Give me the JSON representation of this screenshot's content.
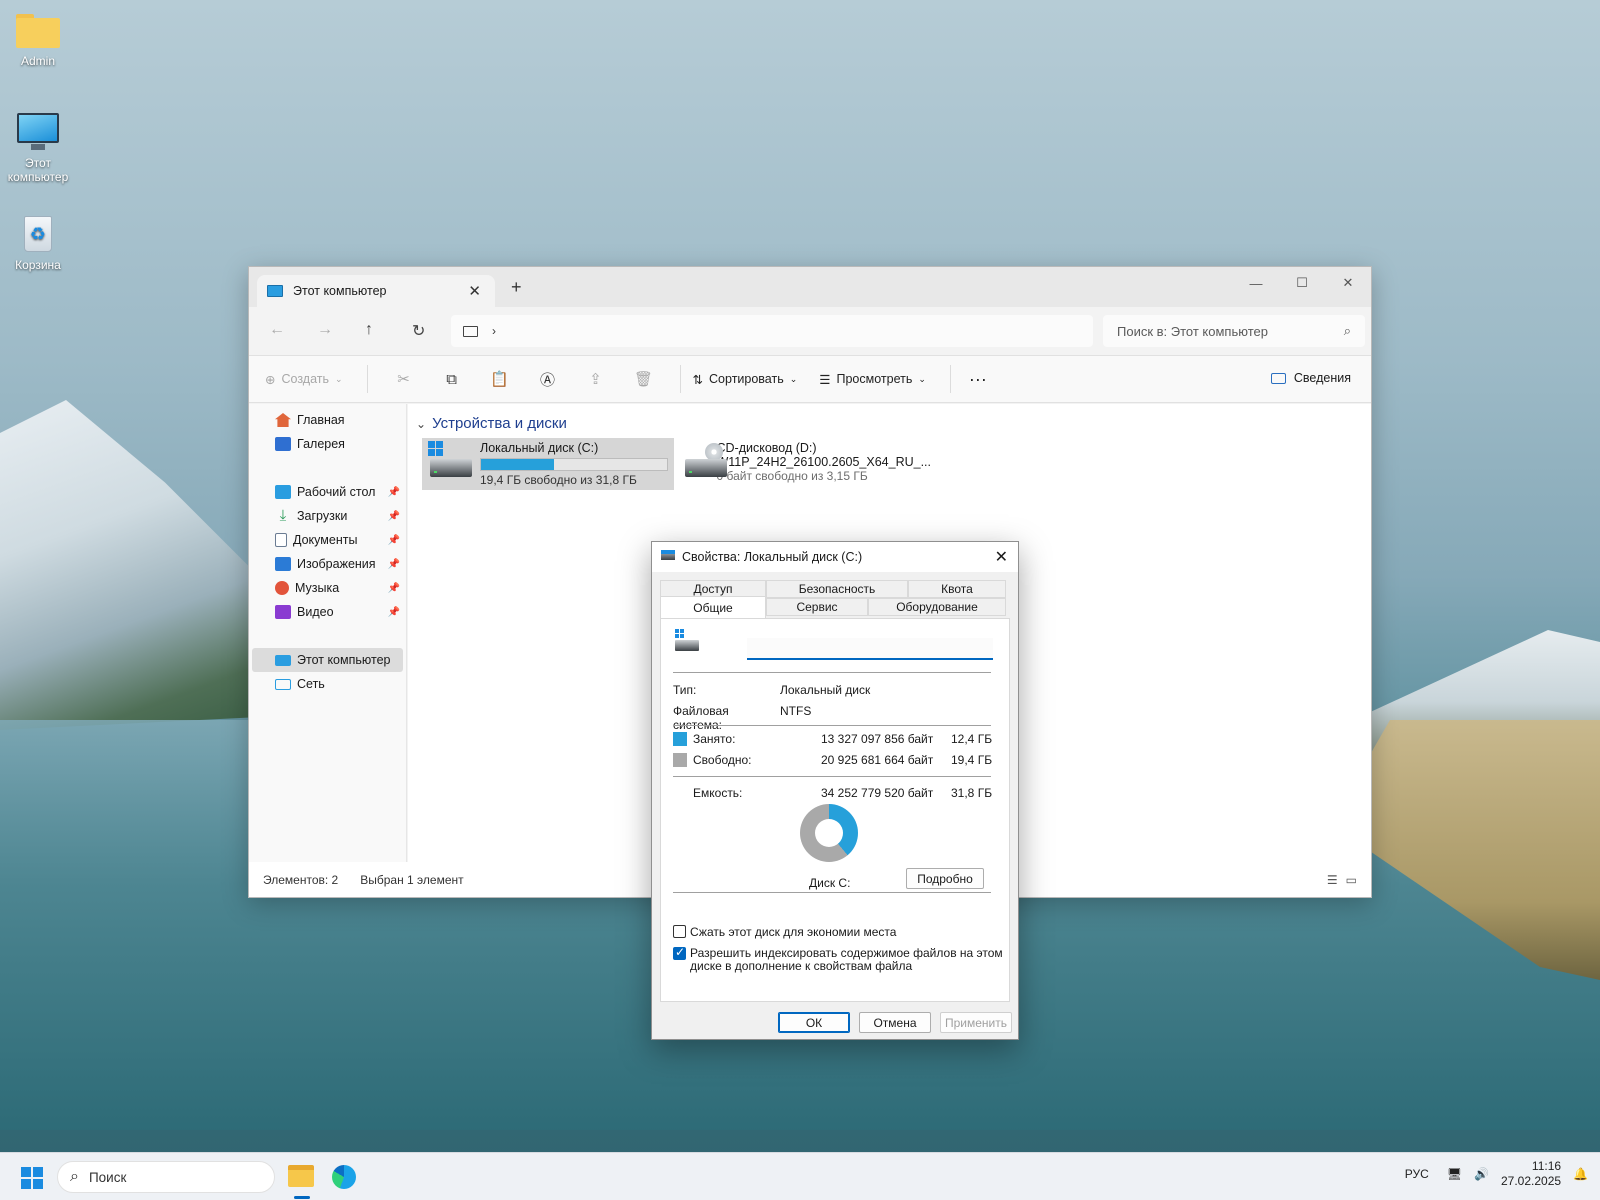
{
  "desktop": {
    "icons": [
      {
        "label": "Admin",
        "icon": "folder-icon"
      },
      {
        "label": "Этот компьютер",
        "icon": "monitor-icon"
      },
      {
        "label": "Корзина",
        "icon": "recycle-bin-icon"
      }
    ]
  },
  "explorer": {
    "tab_title": "Этот компьютер",
    "search_placeholder": "Поиск в: Этот компьютер",
    "toolbar": {
      "create": "Создать",
      "sort": "Сортировать",
      "view": "Просмотреть",
      "details": "Сведения"
    },
    "sidebar": {
      "items": [
        {
          "label": "Главная",
          "icon": "home-icon",
          "color": "#e0663b"
        },
        {
          "label": "Галерея",
          "icon": "gallery-icon",
          "color": "#2f6fd1"
        },
        {
          "label": "Рабочий стол",
          "icon": "desktop-icon",
          "color": "#2a9de0",
          "pinned": true
        },
        {
          "label": "Загрузки",
          "icon": "download-icon",
          "color": "#2c9b5a",
          "pinned": true
        },
        {
          "label": "Документы",
          "icon": "document-icon",
          "color": "#6b7c93",
          "pinned": true
        },
        {
          "label": "Изображения",
          "icon": "images-icon",
          "color": "#2b7bd6",
          "pinned": true
        },
        {
          "label": "Музыка",
          "icon": "music-icon",
          "color": "#e2543b",
          "pinned": true
        },
        {
          "label": "Видео",
          "icon": "video-icon",
          "color": "#8a3bd1",
          "pinned": true
        },
        {
          "label": "Этот компьютер",
          "icon": "pc-icon",
          "color": "#2a9de0",
          "selected": true
        },
        {
          "label": "Сеть",
          "icon": "network-icon",
          "color": "#2a9de0"
        }
      ]
    },
    "section_title": "Устройства и диски",
    "drives": [
      {
        "name": "Локальный диск (C:)",
        "free_text": "19,4 ГБ свободно из 31,8 ГБ",
        "used_fraction": 0.39,
        "selected": true
      },
      {
        "name": "CD-дисковод (D:)",
        "volume": "W11P_24H2_26100.2605_X64_RU_...",
        "free_text": "0 байт свободно из 3,15 ГБ"
      }
    ],
    "status": {
      "count": "Элементов: 2",
      "selected": "Выбран 1 элемент"
    }
  },
  "dialog": {
    "title": "Свойства: Локальный диск (C:)",
    "tabs_top": [
      "Доступ",
      "Безопасность",
      "Квота"
    ],
    "tabs_bottom": [
      "Общие",
      "Сервис",
      "Оборудование"
    ],
    "active_tab": "Общие",
    "name_value": "",
    "type_label": "Тип:",
    "type_value": "Локальный диск",
    "fs_label": "Файловая система:",
    "fs_value": "NTFS",
    "used_label": "Занято:",
    "used_bytes": "13 327 097 856 байт",
    "used_size": "12,4 ГБ",
    "free_label": "Свободно:",
    "free_bytes": "20 925 681 664 байт",
    "free_size": "19,4 ГБ",
    "capacity_label": "Емкость:",
    "capacity_bytes": "34 252 779 520 байт",
    "capacity_size": "31,8 ГБ",
    "disk_label": "Диск C:",
    "details_button": "Подробно",
    "compress_label": "Сжать этот диск для экономии места",
    "compress_checked": false,
    "index_label_1": "Разрешить индексировать содержимое файлов на этом",
    "index_label_2": "диске в дополнение к свойствам файла",
    "index_checked": true,
    "ok": "ОК",
    "cancel": "Отмена",
    "apply": "Применить",
    "used_color": "#26a0da",
    "free_color": "#a9a9a9"
  },
  "taskbar": {
    "search_placeholder": "Поиск",
    "lang": "РУС",
    "time": "11:16",
    "date": "27.02.2025"
  }
}
